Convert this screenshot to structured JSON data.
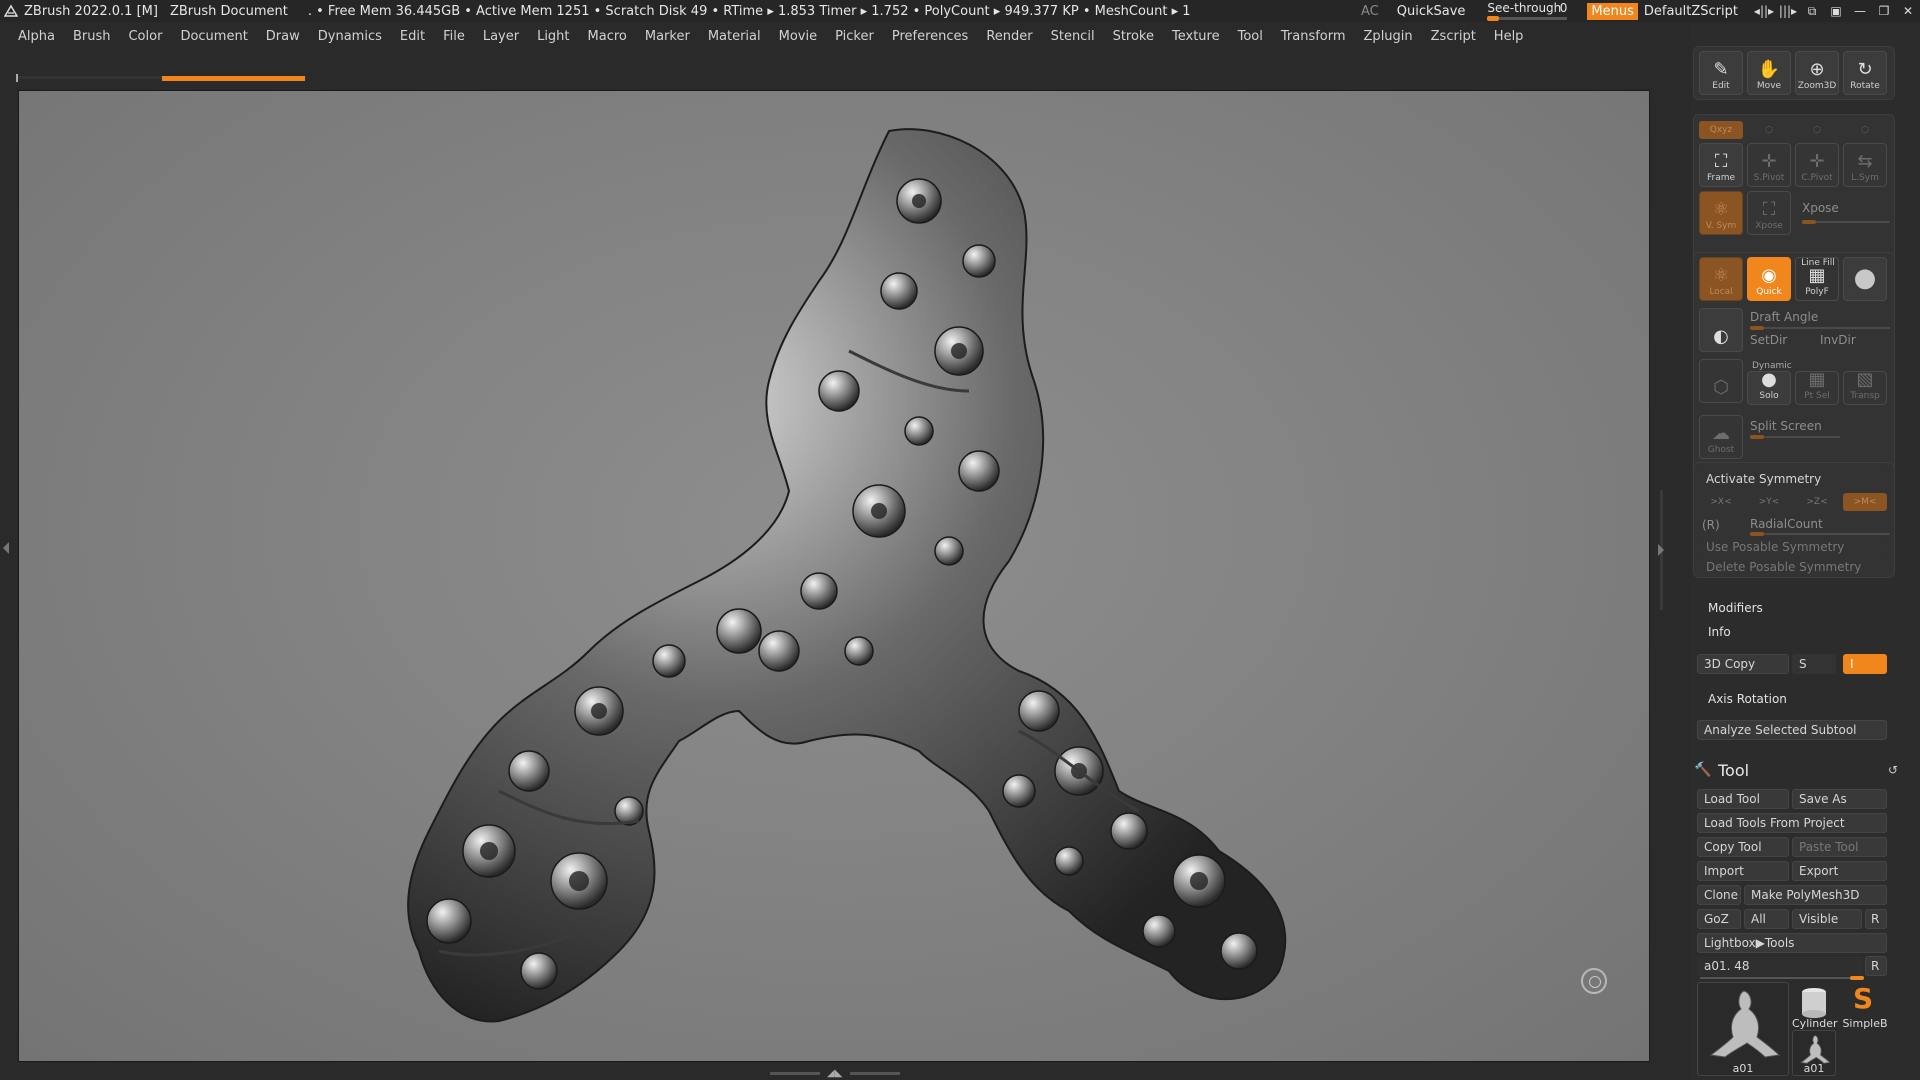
{
  "titlebar": {
    "app": "ZBrush 2022.0.1 [M]",
    "document": "ZBrush Document",
    "stats": ". • Free Mem 36.445GB • Active Mem 1251 • Scratch Disk 49 •  RTime ▸ 1.853 Timer ▸ 1.752 • PolyCount ▸ 949.377 KP  • MeshCount ▸ 1",
    "ac": "AC",
    "quicksave": "QuickSave",
    "seethrough_label": "See-through",
    "seethrough_value": "0",
    "seethrough_level": 0,
    "menus": "Menus",
    "script": "DefaultZScript"
  },
  "menubar": [
    "Alpha",
    "Brush",
    "Color",
    "Document",
    "Draw",
    "Dynamics",
    "Edit",
    "File",
    "Layer",
    "Light",
    "Macro",
    "Marker",
    "Material",
    "Movie",
    "Picker",
    "Preferences",
    "Render",
    "Stencil",
    "Stroke",
    "Texture",
    "Tool",
    "Transform",
    "Zplugin",
    "Zscript",
    "Help"
  ],
  "colors": {
    "accent": "#f0861c",
    "canvas": "#828282",
    "panel": "#2c2c2c"
  },
  "nav_buttons": [
    "Edit",
    "Move",
    "Zoom3D",
    "Rotate"
  ],
  "xyz_row": [
    "Qxyz"
  ],
  "frame_row": [
    "Frame",
    "S.Pivot",
    "C.Pivot",
    "L.Sym"
  ],
  "vsym_row": [
    "V. Sym",
    "Xpose"
  ],
  "xpose_label": "Xpose",
  "render_row": {
    "local": "Local",
    "quick": "Quick",
    "linefill": "Line Fill",
    "polyf": "PolyF"
  },
  "draft_angle": "Draft Angle",
  "setdir": "SetDir",
  "invdir": "InvDir",
  "dynamic_label": "Dynamic",
  "solo_row": [
    "Solo",
    "Pt Sel",
    "Transp"
  ],
  "ghost": "Ghost",
  "split_screen": "Split Screen",
  "symmetry": {
    "activate": "Activate Symmetry",
    "axes": [
      ">X<",
      ">Y<",
      ">Z<",
      ">M<"
    ],
    "r": "(R)",
    "radial": "RadialCount",
    "use_posable": "Use Posable Symmetry",
    "delete_posable": "Delete Posable Symmetry"
  },
  "modifiers": "Modifiers",
  "info": "Info",
  "copy3d": {
    "label": "3D Copy",
    "s": "S",
    "i": "I"
  },
  "axis_rotation": "Axis Rotation",
  "analyze": "Analyze Selected Subtool",
  "tool": {
    "title": "Tool",
    "load": "Load Tool",
    "save_as": "Save As",
    "load_project": "Load Tools From Project",
    "copy": "Copy Tool",
    "paste": "Paste Tool",
    "import": "Import",
    "export": "Export",
    "clone": "Clone",
    "make_polymesh": "Make PolyMesh3D",
    "goz": "GoZ",
    "all": "All",
    "visible": "Visible",
    "r": "R",
    "lightbox": "Lightbox▶Tools",
    "current": "a01. 48",
    "current_r": "R",
    "thumbs": [
      "a01",
      "Cylinder",
      "SimpleB",
      "a01"
    ]
  }
}
